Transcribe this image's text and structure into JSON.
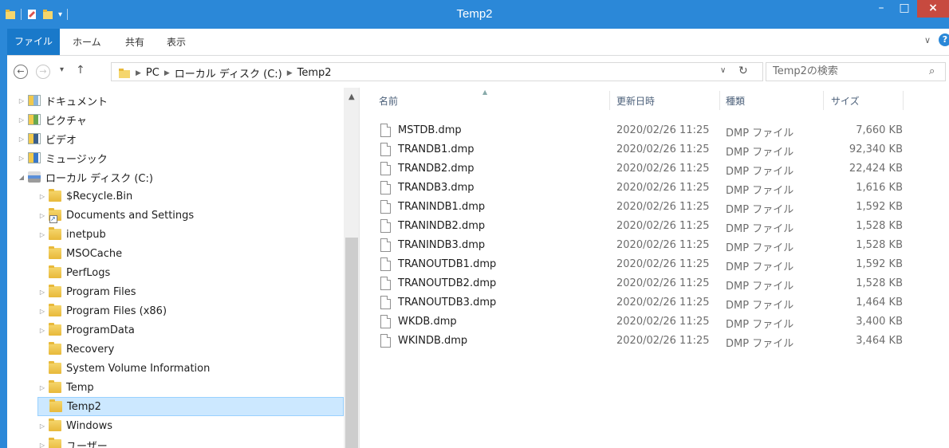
{
  "window": {
    "title": "Temp2",
    "minimize_label": "–",
    "maximize_label": "□",
    "close_label": "×"
  },
  "ribbon": {
    "tabs": [
      {
        "label": "ファイル"
      },
      {
        "label": "ホーム"
      },
      {
        "label": "共有"
      },
      {
        "label": "表示"
      }
    ],
    "expand_label": "∨",
    "help_label": "?"
  },
  "address": {
    "back_label": "←",
    "forward_label": "→",
    "recent_label": "▾",
    "up_label": "↑",
    "crumbs": [
      "PC",
      "ローカル ディスク (C:)",
      "Temp2"
    ],
    "dropdown_label": "∨",
    "refresh_label": "↻"
  },
  "search": {
    "placeholder": "Temp2の検索",
    "icon_label": "⌕"
  },
  "nav_tree": [
    {
      "label": "ドキュメント",
      "icon": "documents-library-icon",
      "expander": "▷"
    },
    {
      "label": "ピクチャ",
      "icon": "pictures-library-icon",
      "expander": "▷"
    },
    {
      "label": "ビデオ",
      "icon": "videos-library-icon",
      "expander": "▷"
    },
    {
      "label": "ミュージック",
      "icon": "music-library-icon",
      "expander": "▷"
    },
    {
      "label": "ローカル ディスク (C:)",
      "icon": "local-disk-icon",
      "expander": "◢"
    },
    {
      "label": "$Recycle.Bin",
      "icon": "folder-icon",
      "expander": "▷"
    },
    {
      "label": "Documents and Settings",
      "icon": "folder-shortcut-icon",
      "expander": "▷"
    },
    {
      "label": "inetpub",
      "icon": "folder-icon",
      "expander": "▷"
    },
    {
      "label": "MSOCache",
      "icon": "folder-icon",
      "expander": ""
    },
    {
      "label": "PerfLogs",
      "icon": "folder-icon",
      "expander": ""
    },
    {
      "label": "Program Files",
      "icon": "folder-icon",
      "expander": "▷"
    },
    {
      "label": "Program Files (x86)",
      "icon": "folder-icon",
      "expander": "▷"
    },
    {
      "label": "ProgramData",
      "icon": "folder-icon",
      "expander": "▷"
    },
    {
      "label": "Recovery",
      "icon": "folder-icon",
      "expander": ""
    },
    {
      "label": "System Volume Information",
      "icon": "folder-icon",
      "expander": ""
    },
    {
      "label": "Temp",
      "icon": "folder-icon",
      "expander": "▷"
    },
    {
      "label": "Temp2",
      "icon": "folder-icon",
      "expander": "",
      "selected": true
    },
    {
      "label": "Windows",
      "icon": "folder-icon",
      "expander": "▷"
    },
    {
      "label": "ユーザー",
      "icon": "folder-icon",
      "expander": "▷"
    }
  ],
  "scroll_up_label": "▲",
  "columns": {
    "name": "名前",
    "date": "更新日時",
    "type": "種類",
    "size": "サイズ",
    "sort_indicator": "▲"
  },
  "files": [
    {
      "name": "MSTDB.dmp",
      "date": "2020/02/26 11:25",
      "type": "DMP ファイル",
      "size": "7,660 KB"
    },
    {
      "name": "TRANDB1.dmp",
      "date": "2020/02/26 11:25",
      "type": "DMP ファイル",
      "size": "92,340 KB"
    },
    {
      "name": "TRANDB2.dmp",
      "date": "2020/02/26 11:25",
      "type": "DMP ファイル",
      "size": "22,424 KB"
    },
    {
      "name": "TRANDB3.dmp",
      "date": "2020/02/26 11:25",
      "type": "DMP ファイル",
      "size": "1,616 KB"
    },
    {
      "name": "TRANINDB1.dmp",
      "date": "2020/02/26 11:25",
      "type": "DMP ファイル",
      "size": "1,592 KB"
    },
    {
      "name": "TRANINDB2.dmp",
      "date": "2020/02/26 11:25",
      "type": "DMP ファイル",
      "size": "1,528 KB"
    },
    {
      "name": "TRANINDB3.dmp",
      "date": "2020/02/26 11:25",
      "type": "DMP ファイル",
      "size": "1,528 KB"
    },
    {
      "name": "TRANOUTDB1.dmp",
      "date": "2020/02/26 11:25",
      "type": "DMP ファイル",
      "size": "1,592 KB"
    },
    {
      "name": "TRANOUTDB2.dmp",
      "date": "2020/02/26 11:25",
      "type": "DMP ファイル",
      "size": "1,528 KB"
    },
    {
      "name": "TRANOUTDB3.dmp",
      "date": "2020/02/26 11:25",
      "type": "DMP ファイル",
      "size": "1,464 KB"
    },
    {
      "name": "WKDB.dmp",
      "date": "2020/02/26 11:25",
      "type": "DMP ファイル",
      "size": "3,400 KB"
    },
    {
      "name": "WKINDB.dmp",
      "date": "2020/02/26 11:25",
      "type": "DMP ファイル",
      "size": "3,464 KB"
    }
  ],
  "colors": {
    "accent": "#2b88d8",
    "file_tab": "#1979ca",
    "close": "#c74a3f",
    "selection": "#cce8ff"
  }
}
